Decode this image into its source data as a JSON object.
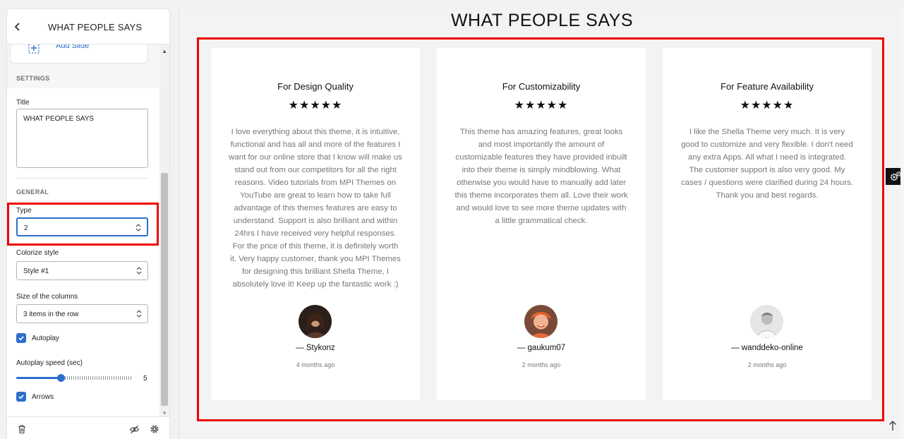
{
  "panel": {
    "title": "WHAT PEOPLE SAYS",
    "add_slide_label": "Add Slide",
    "settings_section": "SETTINGS",
    "title_field": {
      "label": "Title",
      "value": "WHAT PEOPLE SAYS"
    },
    "general_section": "GENERAL",
    "type_field": {
      "label": "Type",
      "value": "2"
    },
    "colorize_field": {
      "label": "Colorize style",
      "value": "Style #1"
    },
    "columns_field": {
      "label": "Size of the columns",
      "value": "3 items in the row"
    },
    "autoplay": {
      "label": "Autoplay",
      "checked": true
    },
    "autoplay_speed": {
      "label": "Autoplay speed (sec)",
      "value": "5"
    },
    "arrows": {
      "label": "Arrows",
      "checked": true
    }
  },
  "preview": {
    "heading": "WHAT PEOPLE SAYS",
    "testimonials": [
      {
        "title": "For Design Quality",
        "stars": "★★★★★",
        "text": "I love everything about this theme, it is intuitive, functional and has all and more of the features I want for our online store that I know will make us stand out from our competitors for all the right reasons. Video tutorials from MPI Themes on YouTube are great to learn how to take full advantage of this themes features are easy to understand. Support is also brilliant and within 24hrs I have received very helpful responses. For the price of this theme, it is definitely worth it. Very happy customer, thank you MPI Themes for designing this brilliant Shella Theme, I absolutely love it! Keep up the fantastic work :)",
        "author": "— Stykonz",
        "time": "4 months ago"
      },
      {
        "title": "For Customizability",
        "stars": "★★★★★",
        "text": "This theme has amazing features, great looks and most importantly the amount of customizable features they have provided inbuilt into their theme is simply mindblowing. What otherwise you would have to manually add later this theme incorporates them all. Love their work and would love to see more theme updates with a little grammatical check.",
        "author": "— gaukum07",
        "time": "2 months ago"
      },
      {
        "title": "For Feature Availability",
        "stars": "★★★★★",
        "text": "I like the Shella Theme very much. It is very good to customize and very flexible. I don't need any extra Apps. All what I need is integrated. The customer support is also very good. My cases / questions were clarified during 24 hours. Thank you and best regards.",
        "author": "— wanddeko-online",
        "time": "2 months ago"
      }
    ]
  },
  "colors": {
    "accent": "#2c6ecb",
    "highlight": "#ee0000"
  }
}
